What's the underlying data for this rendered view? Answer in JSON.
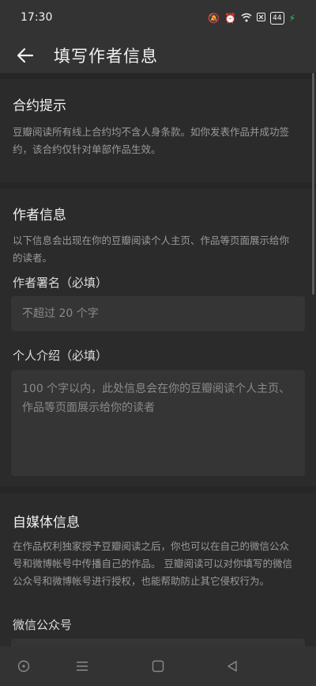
{
  "status": {
    "time": "17:30",
    "battery": "44"
  },
  "header": {
    "title": "填写作者信息"
  },
  "contract": {
    "title": "合约提示",
    "desc": "豆瓣阅读所有线上合约均不含人身条款。如你发表作品并成功签约，该合约仅针对单部作品生效。"
  },
  "author": {
    "title": "作者信息",
    "desc": "以下信息会出现在你的豆瓣阅读个人主页、作品等页面展示给你的读者。",
    "name_label": "作者署名（必填）",
    "name_placeholder": "不超过 20 个字",
    "bio_label": "个人介绍（必填）",
    "bio_placeholder": "100 个字以内，此处信息会在你的豆瓣阅读个人主页、作品等页面展示给你的读者"
  },
  "media": {
    "title": "自媒体信息",
    "desc": "在作品权利独家授予豆瓣阅读之后，你也可以在自己的微信公众号和微博帐号中传播自己的作品。 豆瓣阅读可以对你填写的微信公众号和微博帐号进行授权，也能帮助防止其它侵权行为。",
    "wechat_label": "微信公众号"
  },
  "icons": {
    "back": "arrow-left-icon",
    "nav_assist": "circle-dot-icon",
    "nav_menu": "menu-lines-icon",
    "nav_home": "square-icon",
    "nav_back": "triangle-back-icon"
  }
}
